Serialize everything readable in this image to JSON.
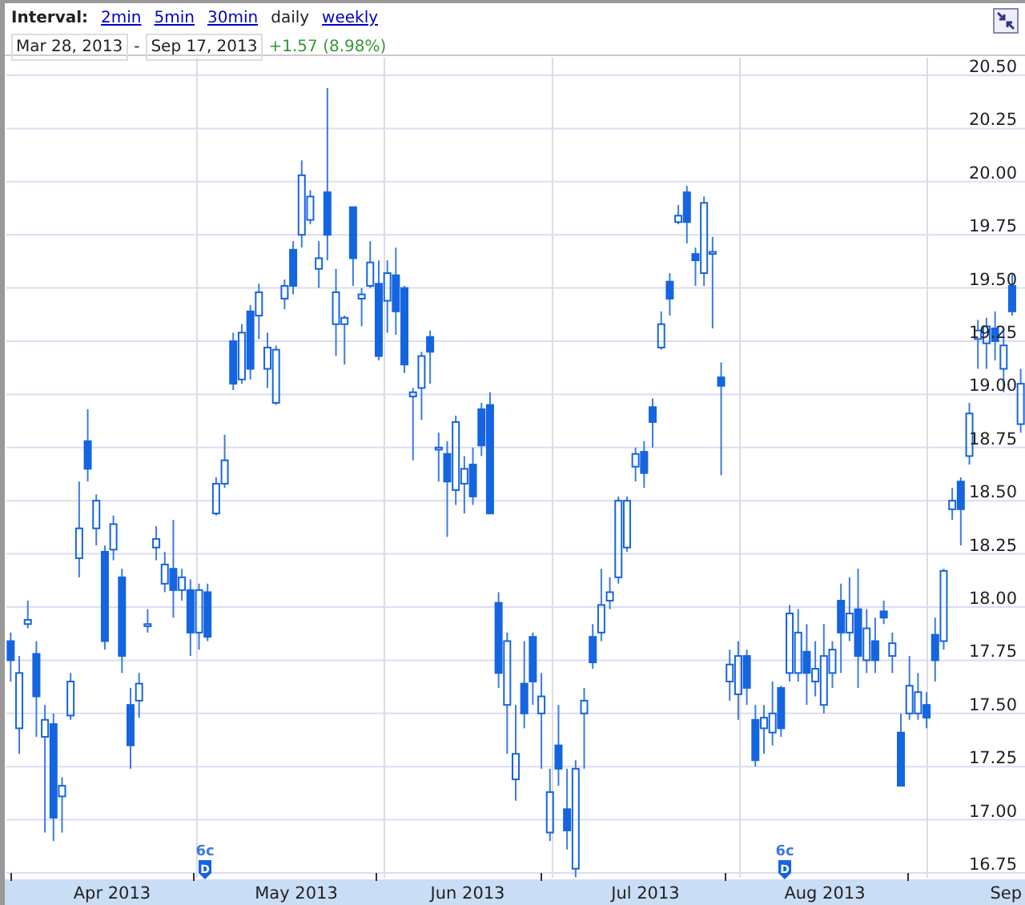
{
  "toolbar": {
    "interval_label": "Interval:",
    "intervals": [
      {
        "label": "2min",
        "selected": false
      },
      {
        "label": "5min",
        "selected": false
      },
      {
        "label": "30min",
        "selected": false
      },
      {
        "label": "daily",
        "selected": true
      },
      {
        "label": "weekly",
        "selected": false
      }
    ],
    "start_date": "Mar 28, 2013",
    "separator": "-",
    "end_date": "Sep 17, 2013",
    "change": "+1.57 (8.98%)"
  },
  "x_axis": {
    "months": [
      "Apr 2013",
      "May 2013",
      "Jun 2013",
      "Jul 2013",
      "Aug 2013",
      "Sep"
    ]
  },
  "dividend_markers": [
    {
      "amount": "6c",
      "flag": "D"
    },
    {
      "amount": "6c",
      "flag": "D"
    }
  ],
  "chart_data": {
    "type": "candlestick",
    "ylim": [
      16.75,
      20.5
    ],
    "grid": true,
    "yticks": [
      {
        "value": 20.5,
        "label": "20.50"
      },
      {
        "value": 20.25,
        "label": "20.25"
      },
      {
        "value": 20,
        "label": "20.00"
      },
      {
        "value": 19.75,
        "label": "19.75"
      },
      {
        "value": 19.5,
        "label": "19.50"
      },
      {
        "value": 19.25,
        "label": "19.25"
      },
      {
        "value": 19,
        "label": "19.00"
      },
      {
        "value": 18.75,
        "label": "18.75"
      },
      {
        "value": 18.5,
        "label": "18.50"
      },
      {
        "value": 18.25,
        "label": "18.25"
      },
      {
        "value": 18,
        "label": "18.00"
      },
      {
        "value": 17.75,
        "label": "17.75"
      },
      {
        "value": 17.5,
        "label": "17.50"
      },
      {
        "value": 17.25,
        "label": "17.25"
      },
      {
        "value": 17,
        "label": "17.00"
      },
      {
        "value": 16.75,
        "label": "16.75"
      }
    ],
    "ohlc": [
      [
        17.84,
        17.88,
        17.65,
        17.75
      ],
      [
        17.43,
        17.77,
        17.31,
        17.69
      ],
      [
        17.92,
        18.03,
        17.9,
        17.94
      ],
      [
        17.78,
        17.84,
        17.39,
        17.58
      ],
      [
        17.39,
        17.54,
        16.94,
        17.47
      ],
      [
        17.45,
        17.5,
        16.9,
        17.01
      ],
      [
        17.11,
        17.2,
        16.94,
        17.16
      ],
      [
        17.49,
        17.69,
        17.47,
        17.65
      ],
      [
        18.23,
        18.59,
        18.14,
        18.37
      ],
      [
        18.78,
        18.93,
        18.59,
        18.65
      ],
      [
        18.37,
        18.53,
        18.29,
        18.5
      ],
      [
        18.26,
        18.29,
        17.8,
        17.84
      ],
      [
        18.27,
        18.43,
        18.22,
        18.39
      ],
      [
        18.14,
        18.18,
        17.69,
        17.77
      ],
      [
        17.54,
        17.62,
        17.24,
        17.35
      ],
      [
        17.56,
        17.69,
        17.48,
        17.64
      ],
      [
        17.91,
        17.99,
        17.88,
        17.92
      ],
      [
        18.28,
        18.38,
        18.22,
        18.32
      ],
      [
        18.11,
        18.26,
        18.07,
        18.2
      ],
      [
        18.18,
        18.41,
        17.95,
        18.08
      ],
      [
        18.08,
        18.18,
        18.03,
        18.14
      ],
      [
        18.08,
        18.13,
        17.77,
        17.88
      ],
      [
        17.88,
        18.11,
        17.8,
        18.08
      ],
      [
        18.07,
        18.11,
        17.84,
        17.86
      ],
      [
        18.44,
        18.61,
        18.43,
        18.58
      ],
      [
        18.58,
        18.81,
        18.56,
        18.69
      ],
      [
        19.25,
        19.29,
        19.02,
        19.05
      ],
      [
        19.07,
        19.33,
        19.05,
        19.29
      ],
      [
        19.39,
        19.42,
        19.07,
        19.12
      ],
      [
        19.37,
        19.52,
        19.26,
        19.48
      ],
      [
        19.12,
        19.29,
        19.03,
        19.22
      ],
      [
        18.96,
        19.23,
        18.95,
        19.21
      ],
      [
        19.45,
        19.54,
        19.4,
        19.51
      ],
      [
        19.68,
        19.72,
        19.47,
        19.51
      ],
      [
        19.75,
        20.1,
        19.69,
        20.03
      ],
      [
        19.82,
        19.96,
        19.8,
        19.93
      ],
      [
        19.59,
        19.72,
        19.5,
        19.64
      ],
      [
        19.95,
        20.44,
        19.63,
        19.75
      ],
      [
        19.33,
        19.59,
        19.18,
        19.48
      ],
      [
        19.33,
        19.37,
        19.14,
        19.36
      ],
      [
        19.88,
        19.88,
        19.51,
        19.64
      ],
      [
        19.45,
        19.5,
        19.32,
        19.47
      ],
      [
        19.51,
        19.72,
        19.5,
        19.62
      ],
      [
        19.52,
        19.63,
        19.16,
        19.18
      ],
      [
        19.44,
        19.63,
        19.29,
        19.57
      ],
      [
        19.56,
        19.69,
        19.28,
        19.39
      ],
      [
        19.5,
        19.51,
        19.1,
        19.14
      ],
      [
        18.99,
        19.03,
        18.69,
        19.01
      ],
      [
        19.03,
        19.2,
        18.88,
        19.18
      ],
      [
        19.27,
        19.3,
        19.05,
        19.2
      ],
      [
        18.74,
        18.82,
        18.59,
        18.75
      ],
      [
        18.72,
        18.78,
        18.33,
        18.59
      ],
      [
        18.55,
        18.9,
        18.48,
        18.87
      ],
      [
        18.58,
        18.71,
        18.44,
        18.65
      ],
      [
        18.67,
        18.75,
        18.48,
        18.52
      ],
      [
        18.93,
        18.96,
        18.71,
        18.76
      ],
      [
        18.95,
        19.01,
        18.44,
        18.44
      ],
      [
        18.02,
        18.07,
        17.62,
        17.69
      ],
      [
        17.54,
        17.88,
        17.31,
        17.84
      ],
      [
        17.19,
        17.54,
        17.09,
        17.31
      ],
      [
        17.64,
        17.84,
        17.43,
        17.5
      ],
      [
        17.86,
        17.88,
        17.54,
        17.65
      ],
      [
        17.5,
        17.69,
        17.24,
        17.58
      ],
      [
        16.94,
        17.24,
        16.9,
        17.13
      ],
      [
        17.35,
        17.54,
        17.16,
        17.24
      ],
      [
        17.05,
        17.24,
        16.86,
        16.95
      ],
      [
        16.77,
        17.28,
        16.73,
        17.24
      ],
      [
        17.5,
        17.62,
        17.24,
        17.56
      ],
      [
        17.86,
        17.92,
        17.71,
        17.74
      ],
      [
        17.88,
        18.18,
        17.84,
        18.01
      ],
      [
        18.03,
        18.14,
        17.99,
        18.07
      ],
      [
        18.14,
        18.52,
        18.11,
        18.5
      ],
      [
        18.28,
        18.52,
        18.26,
        18.5
      ],
      [
        18.66,
        18.75,
        18.59,
        18.72
      ],
      [
        18.73,
        18.78,
        18.56,
        18.63
      ],
      [
        18.94,
        18.98,
        18.75,
        18.87
      ],
      [
        19.22,
        19.39,
        19.21,
        19.33
      ],
      [
        19.53,
        19.57,
        19.37,
        19.45
      ],
      [
        19.81,
        19.89,
        19.8,
        19.84
      ],
      [
        19.95,
        19.98,
        19.71,
        19.81
      ],
      [
        19.66,
        19.69,
        19.51,
        19.63
      ],
      [
        19.57,
        19.93,
        19.51,
        19.9
      ],
      [
        19.66,
        19.74,
        19.31,
        19.67
      ],
      [
        19.08,
        19.15,
        18.62,
        19.04
      ],
      [
        17.65,
        17.8,
        17.56,
        17.73
      ],
      [
        17.59,
        17.84,
        17.47,
        17.77
      ],
      [
        17.77,
        17.8,
        17.54,
        17.62
      ],
      [
        17.47,
        17.54,
        17.25,
        17.28
      ],
      [
        17.43,
        17.54,
        17.31,
        17.48
      ],
      [
        17.41,
        17.65,
        17.35,
        17.5
      ],
      [
        17.62,
        17.63,
        17.39,
        17.43
      ],
      [
        17.69,
        18.01,
        17.65,
        17.97
      ],
      [
        17.69,
        17.99,
        17.65,
        17.88
      ],
      [
        17.79,
        17.92,
        17.54,
        17.69
      ],
      [
        17.65,
        17.84,
        17.58,
        17.71
      ],
      [
        17.54,
        17.92,
        17.5,
        17.77
      ],
      [
        17.69,
        17.84,
        17.62,
        17.8
      ],
      [
        18.03,
        18.11,
        17.69,
        17.88
      ],
      [
        17.88,
        18.14,
        17.84,
        17.97
      ],
      [
        17.99,
        18.18,
        17.62,
        17.77
      ],
      [
        17.75,
        17.99,
        17.69,
        17.9
      ],
      [
        17.84,
        17.95,
        17.69,
        17.75
      ],
      [
        17.98,
        18.03,
        17.92,
        17.95
      ],
      [
        17.77,
        17.88,
        17.69,
        17.83
      ],
      [
        17.41,
        17.5,
        17.16,
        17.16
      ],
      [
        17.5,
        17.77,
        17.47,
        17.63
      ],
      [
        17.5,
        17.69,
        17.47,
        17.6
      ],
      [
        17.54,
        17.6,
        17.43,
        17.48
      ],
      [
        17.87,
        17.95,
        17.65,
        17.75
      ],
      [
        17.84,
        18.18,
        17.8,
        18.17
      ],
      [
        18.46,
        18.56,
        18.41,
        18.5
      ],
      [
        18.59,
        18.61,
        18.29,
        18.46
      ],
      [
        18.71,
        18.96,
        18.67,
        18.91
      ],
      [
        19.26,
        19.35,
        19.12,
        19.3
      ],
      [
        19.24,
        19.36,
        19.12,
        19.32
      ],
      [
        19.31,
        19.39,
        19.16,
        19.25
      ],
      [
        19.12,
        19.31,
        19.01,
        19.23
      ],
      [
        19.51,
        19.57,
        19.37,
        19.39
      ],
      [
        18.86,
        19.12,
        18.82,
        19.05
      ]
    ]
  }
}
